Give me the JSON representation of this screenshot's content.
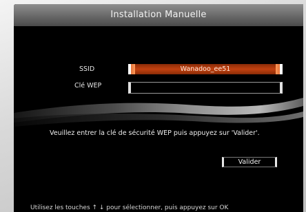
{
  "window": {
    "title": "Installation Manuelle"
  },
  "form": {
    "ssid_label": "SSID",
    "ssid_value": "Wanadoo_ee51",
    "wep_label": "Clé WEP",
    "wep_value": ""
  },
  "instruction": "Veuillez entrer la clé de sécurité WEP puis appuyez sur 'Valider'.",
  "buttons": {
    "validate_label": "Valider"
  },
  "footer": {
    "hint": "Utilisez les touches ↑ ↓ pour sélectionner, puis appuyez sur OK"
  },
  "colors": {
    "screen_bg": "#000000",
    "selected_field": "#c2410f",
    "title_bar": "#6f6f6f",
    "text": "#eeeeee"
  }
}
